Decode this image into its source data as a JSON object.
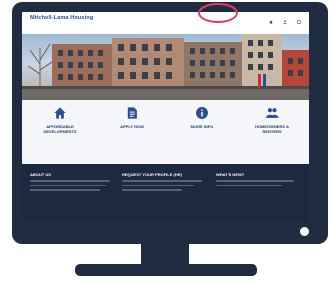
{
  "site": {
    "title": "Mitchell-Lama Housing",
    "subtitle": "",
    "nav": [
      {
        "label": "",
        "icon": "home-icon"
      },
      {
        "label": "",
        "icon": "user-icon"
      },
      {
        "label": "",
        "icon": "help-icon"
      }
    ]
  },
  "actions": [
    {
      "label": "AFFORDABLE\nDEVELOPMENTS",
      "desc": "",
      "icon": "home-icon"
    },
    {
      "label": "APPLY NOW",
      "desc": "",
      "icon": "document-icon"
    },
    {
      "label": "MORE INFO",
      "desc": "",
      "icon": "info-icon"
    },
    {
      "label": "HOMEOWNERS &\nRENTERS",
      "desc": "",
      "icon": "people-icon"
    }
  ],
  "footer": {
    "columns": [
      {
        "heading": "ABOUT US"
      },
      {
        "heading": "REQUEST YOUR PROFILE (HR)"
      },
      {
        "heading": "WHAT'S NEW?"
      }
    ]
  },
  "colors": {
    "frame": "#1f2c42",
    "brand": "#2b4f91",
    "highlight": "#e0415a",
    "footer": "#1d2940"
  }
}
